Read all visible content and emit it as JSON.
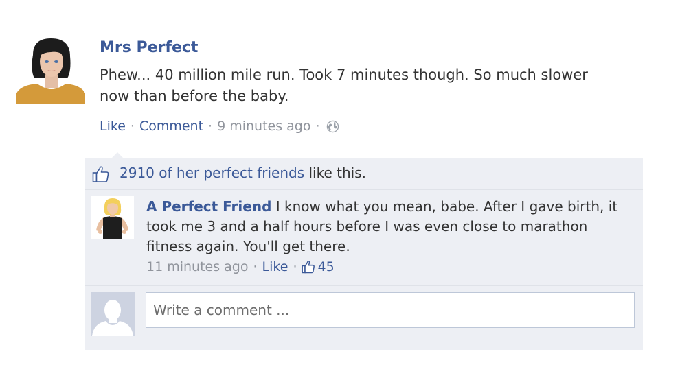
{
  "post": {
    "author": "Mrs Perfect",
    "text": "Phew... 40 million mile run. Took 7 minutes though. So much slower now than before the baby.",
    "like_label": "Like",
    "comment_label": "Comment",
    "timestamp": "9 minutes ago",
    "privacy_icon": "globe-icon"
  },
  "likes": {
    "count_text": "2910 of her perfect friends",
    "suffix": "like this."
  },
  "comment": {
    "author": "A Perfect Friend",
    "text": "I know what you mean, babe. After I gave birth, it took me 3 and a half hours before I was even close to marathon fitness again. You'll get there.",
    "timestamp": "11 minutes ago",
    "like_label": "Like",
    "like_count": "45"
  },
  "composer": {
    "placeholder": "Write a comment ..."
  },
  "colors": {
    "link": "#3b5998",
    "feedback_bg": "#edeff4",
    "muted": "#90949c"
  }
}
